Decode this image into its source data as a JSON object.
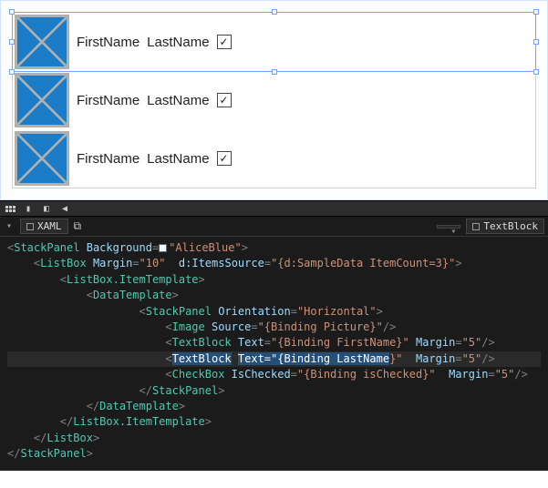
{
  "preview": {
    "items": [
      {
        "first": "FirstName",
        "last": "LastName",
        "checked": true,
        "selected": true
      },
      {
        "first": "FirstName",
        "last": "LastName",
        "checked": true,
        "selected": false
      },
      {
        "first": "FirstName",
        "last": "LastName",
        "checked": true,
        "selected": false
      }
    ]
  },
  "editor": {
    "tab_label": "XAML",
    "breadcrumb_dropdown": "",
    "breadcrumb_selected": "TextBlock",
    "code": {
      "l1_el": "StackPanel",
      "l1_attr": "Background",
      "l1_val": "\"AliceBlue\"",
      "l2_el": "ListBox",
      "l2_a1": "Margin",
      "l2_v1": "\"10\"",
      "l2_a2": "d:ItemsSource",
      "l2_v2": "\"{d:SampleData ItemCount=3}\"",
      "l3_el": "ListBox.ItemTemplate",
      "l4_el": "DataTemplate",
      "l5_el": "StackPanel",
      "l5_a1": "Orientation",
      "l5_v1": "\"Horizontal\"",
      "l6_el": "Image",
      "l6_a1": "Source",
      "l6_v1": "\"{Binding Picture}\"",
      "l7_el": "TextBlock",
      "l7_a1": "Text",
      "l7_v1": "\"{Binding FirstName}\"",
      "l7_a2": "Margin",
      "l7_v2": "\"5\"",
      "l8_el": "TextBlock",
      "l8_a1": "Text",
      "l8_v1_prefix": "\"{Binding ",
      "l8_v1_sel": "LastName",
      "l8_v1_suffix": "}\"",
      "l8_a2": "Margin",
      "l8_v2": "\"5\"",
      "l9_el": "CheckBox",
      "l9_a1": "IsChecked",
      "l9_v1": "\"{Binding isChecked}\"",
      "l9_a2": "Margin",
      "l9_v2": "\"5\"",
      "l10_el": "StackPanel",
      "l11_el": "DataTemplate",
      "l12_el": "ListBox.ItemTemplate",
      "l13_el": "ListBox",
      "l14_el": "StackPanel"
    }
  }
}
